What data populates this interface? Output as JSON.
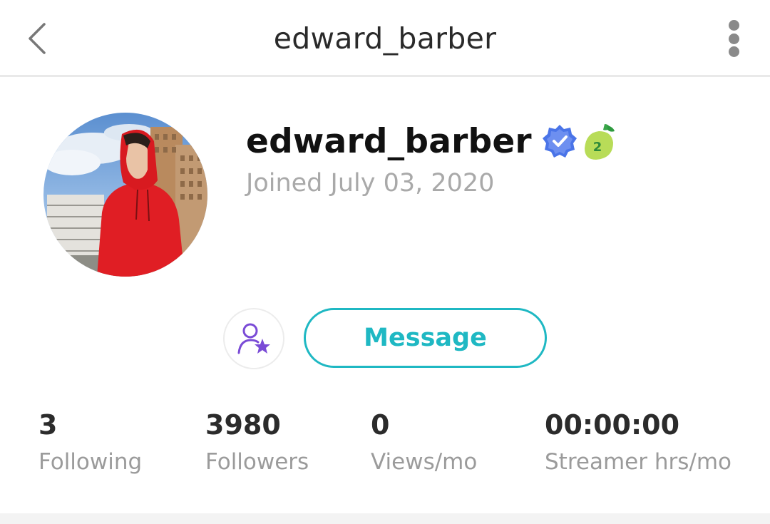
{
  "header": {
    "title": "edward_barber",
    "back_icon": "chevron-left-icon",
    "more_icon": "more-vertical-icon"
  },
  "profile": {
    "username": "edward_barber",
    "joined": "Joined July 03, 2020",
    "level": "2",
    "verified": true
  },
  "actions": {
    "follow_icon": "user-star-icon",
    "message_label": "Message"
  },
  "stats": [
    {
      "value": "3",
      "label": "Following"
    },
    {
      "value": "3980",
      "label": "Followers"
    },
    {
      "value": "0",
      "label": "Views/mo"
    },
    {
      "value": "00:00:00",
      "label": "Streamer hrs/mo"
    }
  ],
  "colors": {
    "accent": "#1fb8c3",
    "verified_blue": "#4a74e8",
    "follow_icon_purple": "#7a4bd6",
    "level_badge_green": "#b8dc58",
    "muted_text": "#a9a9a9"
  }
}
